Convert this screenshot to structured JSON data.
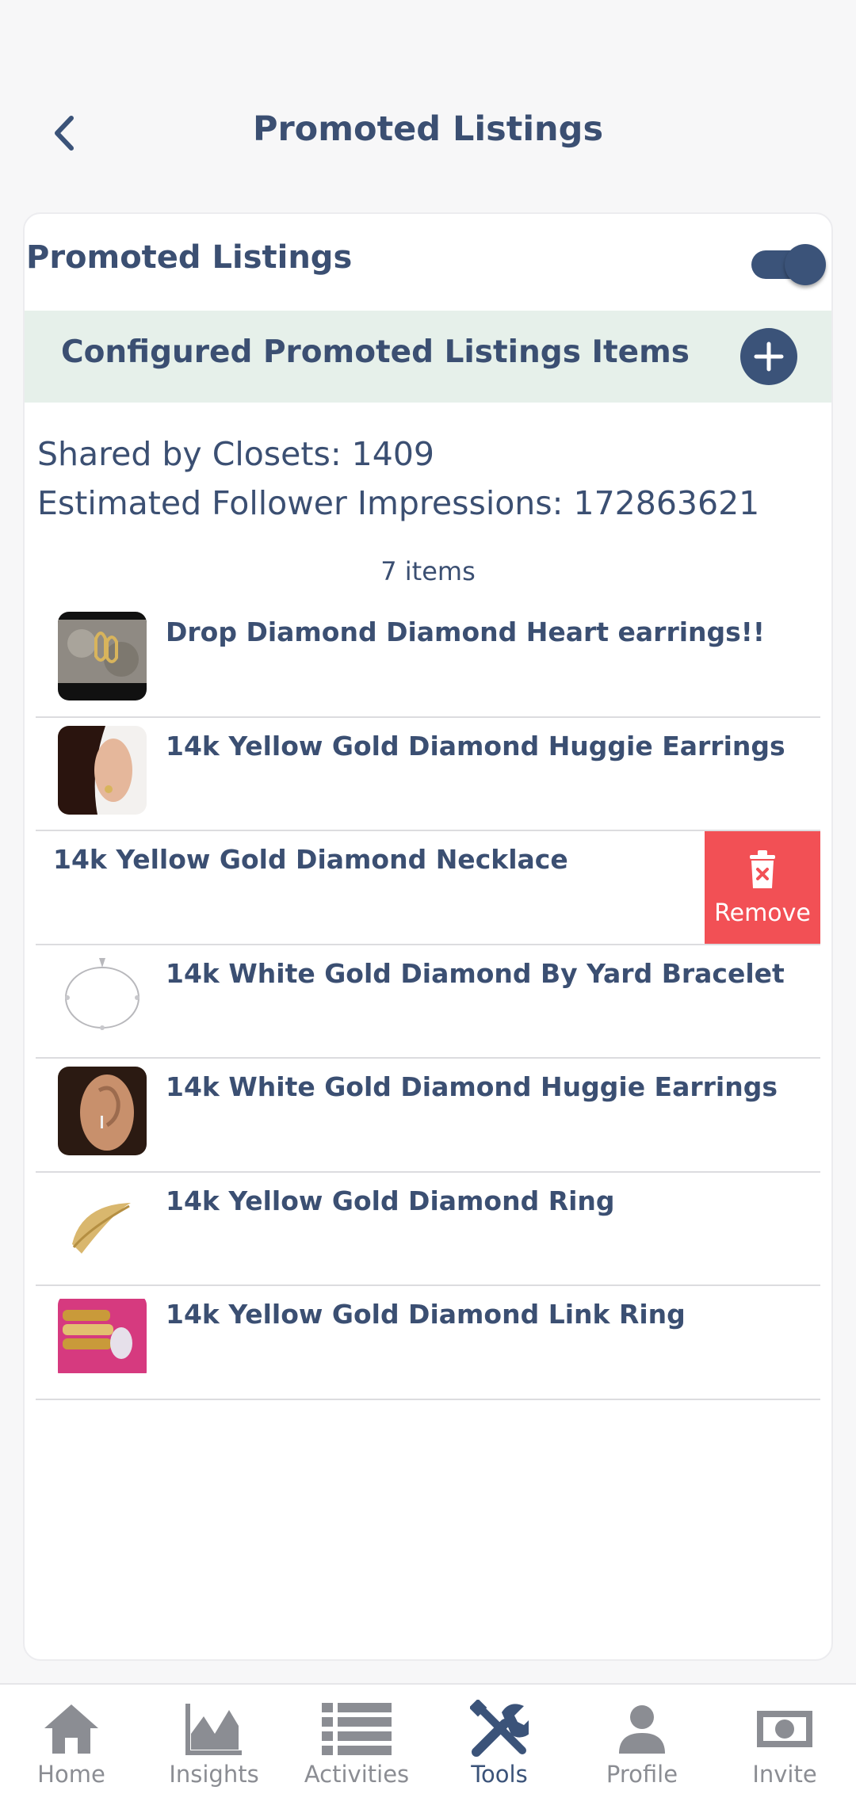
{
  "header": {
    "title": "Promoted Listings"
  },
  "promo": {
    "label": "Promoted Listings",
    "toggle_on": true
  },
  "configured": {
    "label": "Configured Promoted Listings Items"
  },
  "stats": {
    "shared": "Shared by Closets: 1409",
    "impressions": "Estimated Follower Impressions: 172863621"
  },
  "items_count": "7 items",
  "items": [
    {
      "title": "Drop Diamond Diamond Heart earrings!!"
    },
    {
      "title": "14k Yellow Gold Diamond Huggie Earrings"
    },
    {
      "title": "14k Yellow Gold Diamond Necklace"
    },
    {
      "title": "14k White Gold Diamond By Yard Bracelet"
    },
    {
      "title": "14k White Gold Diamond Huggie Earrings"
    },
    {
      "title": "14k Yellow Gold Diamond Ring"
    },
    {
      "title": "14k Yellow Gold Diamond Link Ring"
    }
  ],
  "remove_label": "Remove",
  "tabs": [
    {
      "label": "Home",
      "icon": "home-icon"
    },
    {
      "label": "Insights",
      "icon": "chart-icon"
    },
    {
      "label": "Activities",
      "icon": "list-icon"
    },
    {
      "label": "Tools",
      "icon": "tools-icon"
    },
    {
      "label": "Profile",
      "icon": "person-icon"
    },
    {
      "label": "Invite",
      "icon": "money-icon"
    }
  ],
  "colors": {
    "accent": "#3b5379",
    "remove": "#f25055",
    "config_bg": "#e6f0ea"
  }
}
